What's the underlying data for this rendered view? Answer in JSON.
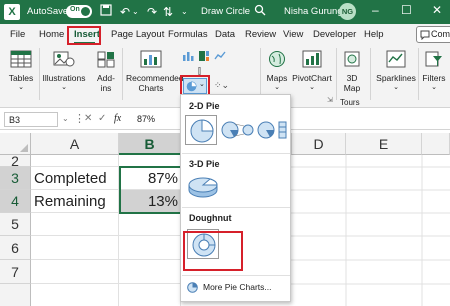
{
  "titlebar": {
    "autosave_label": "AutoSave",
    "autosave_state": "On",
    "doc_title": "Draw Circle",
    "user_name": "Nisha Gurung",
    "user_initials": "NG"
  },
  "tabs": [
    "File",
    "Home",
    "Insert",
    "Page Layout",
    "Formulas",
    "Data",
    "Review",
    "View",
    "Developer",
    "Help"
  ],
  "active_tab": "Insert",
  "comment_label": "Comm",
  "ribbon": {
    "tables": "Tables",
    "illustrations": "Illustrations",
    "addins_1": "Add-",
    "addins_2": "ins",
    "recommended_1": "Recommended",
    "recommended_2": "Charts",
    "maps": "Maps",
    "pivotchart": "PivotChart",
    "map3d_1": "3D",
    "map3d_2": "Map",
    "tours": "Tours",
    "sparklines": "Sparklines",
    "filters": "Filters"
  },
  "formula_bar": {
    "cell_ref": "B3",
    "fx": "fx",
    "value": "87%"
  },
  "grid": {
    "columns": [
      "A",
      "B"
    ],
    "rows": [
      "2",
      "3",
      "4",
      "5",
      "6",
      "7"
    ],
    "cells": [
      {
        "row": "3",
        "label": "Completed",
        "value": "87%"
      },
      {
        "row": "4",
        "label": "Remaining",
        "value": "13%"
      }
    ]
  },
  "right_columns": [
    "D",
    "E"
  ],
  "pie_menu": {
    "section_2d": "2-D Pie",
    "section_3d": "3-D Pie",
    "section_doughnut": "Doughnut",
    "more": "More Pie Charts..."
  },
  "colors": {
    "excel_green": "#217346",
    "highlight_red": "#d6202a",
    "selection_blue": "#5b9bd5"
  }
}
